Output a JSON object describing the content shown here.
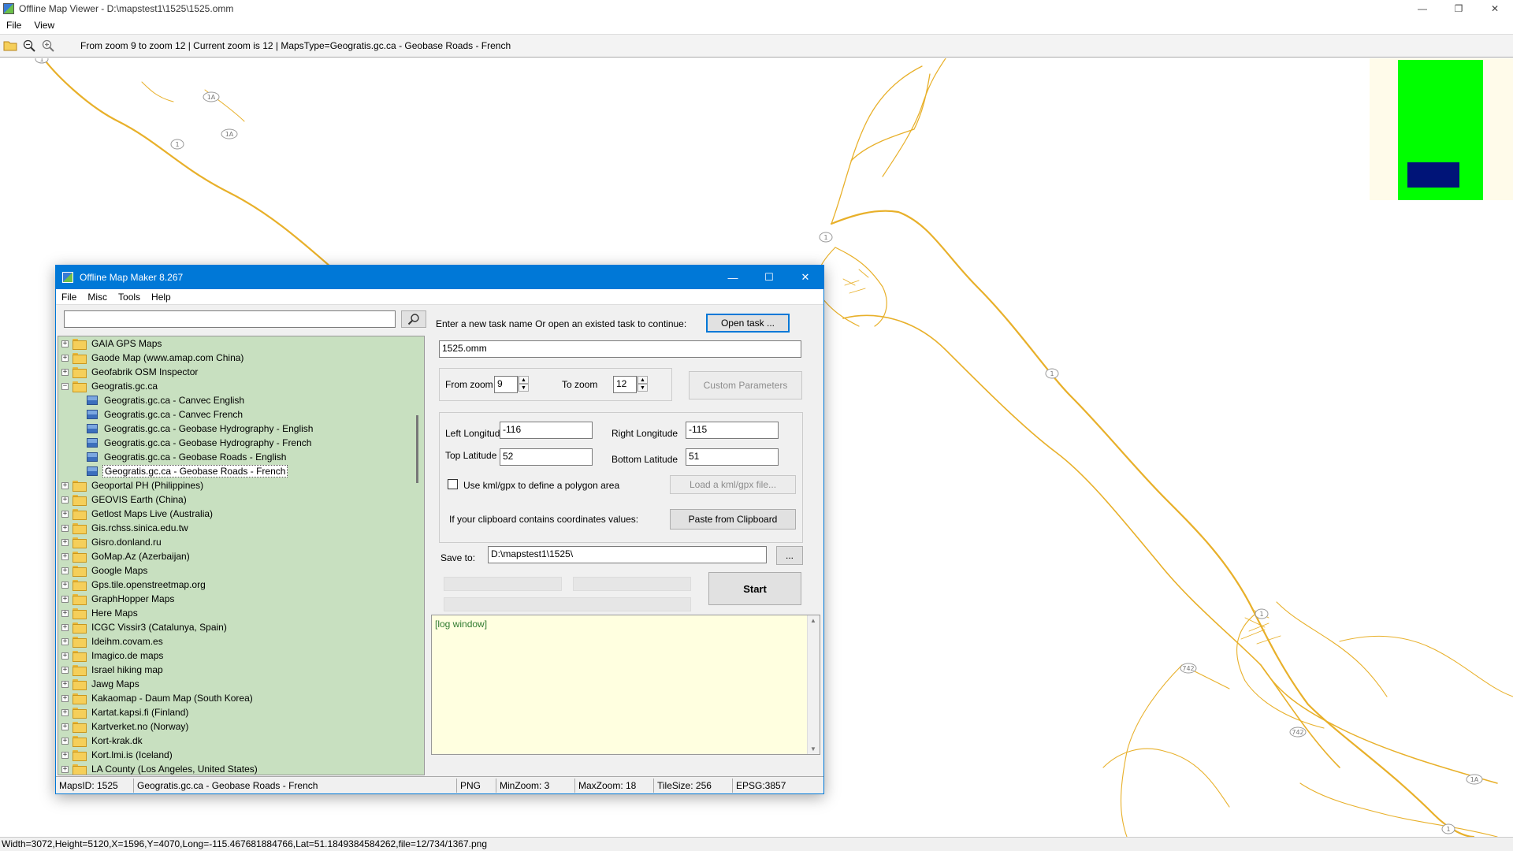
{
  "viewer": {
    "title": "Offline Map Viewer - D:\\mapstest1\\1525\\1525.omm",
    "menu": [
      "File",
      "View"
    ],
    "toolbar_status": "From zoom 9 to zoom 12    |  Current zoom is 12 |   MapsType=Geogratis.gc.ca - Geobase Roads - French",
    "status_bar": "Width=3072,Height=5120,X=1596,Y=4070,Long=-115.467681884766,Lat=51.1849384584262,file=12/734/1367.png",
    "map_labels": [
      "1",
      "1A",
      "1A",
      "1",
      "1",
      "1",
      "1",
      "742",
      "742",
      "1A",
      "1"
    ],
    "colors": {
      "road": "#e8b02a",
      "minimap_bg": "#fffbea",
      "minimap_fill": "#00ff00",
      "minimap_view": "#001478"
    }
  },
  "dialog": {
    "title": "Offline Map Maker 8.267",
    "menu": [
      "File",
      "Misc",
      "Tools",
      "Help"
    ],
    "search": {
      "value": "",
      "placeholder": ""
    },
    "tree": [
      {
        "label": "GAIA GPS Maps",
        "expanded": false
      },
      {
        "label": "Gaode Map (www.amap.com China)",
        "expanded": false
      },
      {
        "label": "Geofabrik OSM Inspector",
        "expanded": false
      },
      {
        "label": "Geogratis.gc.ca",
        "expanded": true,
        "children": [
          {
            "label": "Geogratis.gc.ca - Canvec English"
          },
          {
            "label": "Geogratis.gc.ca - Canvec French"
          },
          {
            "label": "Geogratis.gc.ca - Geobase Hydrography - English"
          },
          {
            "label": "Geogratis.gc.ca - Geobase Hydrography - French"
          },
          {
            "label": "Geogratis.gc.ca - Geobase Roads - English"
          },
          {
            "label": "Geogratis.gc.ca - Geobase Roads - French",
            "selected": true
          }
        ]
      },
      {
        "label": "Geoportal PH (Philippines)",
        "expanded": false
      },
      {
        "label": "GEOVIS Earth (China)",
        "expanded": false
      },
      {
        "label": "Getlost Maps Live (Australia)",
        "expanded": false
      },
      {
        "label": "Gis.rchss.sinica.edu.tw",
        "expanded": false
      },
      {
        "label": "Gisro.donland.ru",
        "expanded": false
      },
      {
        "label": "GoMap.Az (Azerbaijan)",
        "expanded": false
      },
      {
        "label": "Google Maps",
        "expanded": false
      },
      {
        "label": "Gps.tile.openstreetmap.org",
        "expanded": false
      },
      {
        "label": "GraphHopper Maps",
        "expanded": false
      },
      {
        "label": "Here Maps",
        "expanded": false
      },
      {
        "label": "ICGC Vissir3 (Catalunya, Spain)",
        "expanded": false
      },
      {
        "label": "Ideihm.covam.es",
        "expanded": false
      },
      {
        "label": "Imagico.de maps",
        "expanded": false
      },
      {
        "label": "Israel hiking map",
        "expanded": false
      },
      {
        "label": "Jawg Maps",
        "expanded": false
      },
      {
        "label": "Kakaomap - Daum Map (South Korea)",
        "expanded": false
      },
      {
        "label": "Kartat.kapsi.fi (Finland)",
        "expanded": false
      },
      {
        "label": "Kartverket.no (Norway)",
        "expanded": false
      },
      {
        "label": "Kort-krak.dk",
        "expanded": false
      },
      {
        "label": "Kort.lmi.is (Iceland)",
        "expanded": false
      },
      {
        "label": "LA County (Los Angeles, United States)",
        "expanded": false
      }
    ],
    "form": {
      "task_prompt": "Enter a new task name Or open an existed task to continue:",
      "open_task_label": "Open task ...",
      "task_name": "1525.omm",
      "from_zoom_label": "From zoom",
      "from_zoom_value": "9",
      "to_zoom_label": "To zoom",
      "to_zoom_value": "12",
      "custom_params_label": "Custom Parameters",
      "left_lon_label": "Left Longitude",
      "left_lon_value": "-116",
      "right_lon_label": "Right Longitude",
      "right_lon_value": "-115",
      "top_lat_label": "Top Latitude",
      "top_lat_value": "52",
      "bottom_lat_label": "Bottom Latitude",
      "bottom_lat_value": "51",
      "kml_label": "Use kml/gpx to define a polygon area",
      "load_kml_label": "Load a kml/gpx file...",
      "clipboard_prompt": "If your clipboard contains coordinates values:",
      "paste_label": "Paste from Clipboard",
      "save_to_label": "Save to:",
      "save_to_value": "D:\\mapstest1\\1525\\",
      "browse_label": "...",
      "start_label": "Start"
    },
    "log_text": "[log window]",
    "status": {
      "maps_id": "MapsID: 1525",
      "maps_name": "Geogratis.gc.ca - Geobase Roads - French",
      "format": "PNG",
      "min_zoom": "MinZoom: 3",
      "max_zoom": "MaxZoom: 18",
      "tile_size": "TileSize: 256",
      "epsg": "EPSG:3857"
    }
  }
}
